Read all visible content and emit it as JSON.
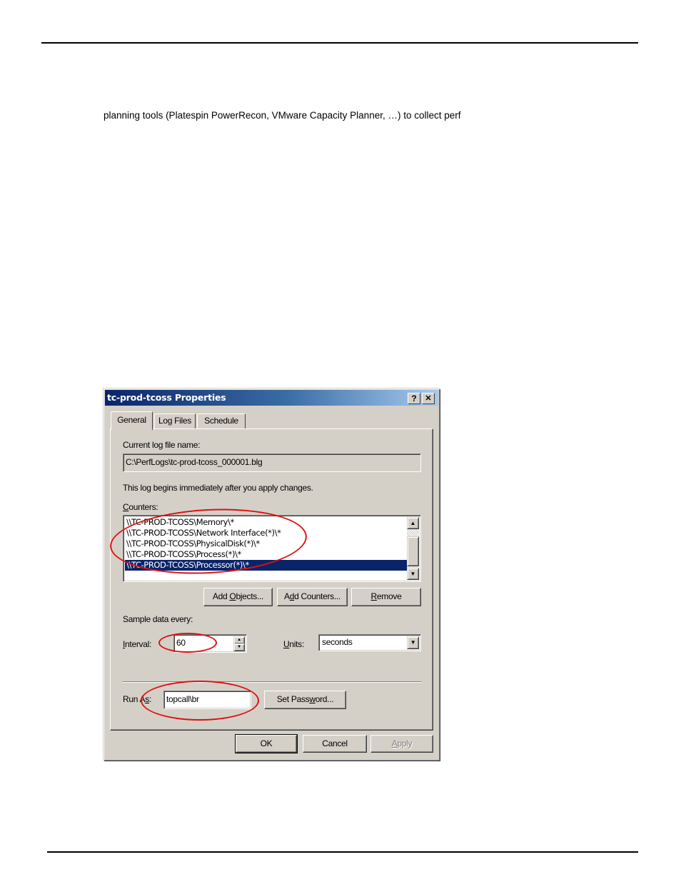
{
  "document": {
    "body_text": "planning tools (Platespin PowerRecon, VMware Capacity Planner, …) to collect perf"
  },
  "dialog": {
    "title": "tc-prod-tcoss Properties",
    "help_button": "?",
    "close_button": "✕",
    "tabs": [
      {
        "label": "General",
        "active": true
      },
      {
        "label": "Log Files",
        "active": false
      },
      {
        "label": "Schedule",
        "active": false
      }
    ],
    "current_log_label": "Current log file name:",
    "current_log_value": "C:\\PerfLogs\\tc-prod-tcoss_000001.blg",
    "log_begins_text": "This log begins immediately after you apply changes.",
    "counters_label_ul": "C",
    "counters_label_rest": "ounters:",
    "counters": [
      {
        "text": "\\\\TC-PROD-TCOSS\\Memory\\*",
        "selected": false
      },
      {
        "text": "\\\\TC-PROD-TCOSS\\Network Interface(*)\\*",
        "selected": false
      },
      {
        "text": "\\\\TC-PROD-TCOSS\\PhysicalDisk(*)\\*",
        "selected": false
      },
      {
        "text": "\\\\TC-PROD-TCOSS\\Process(*)\\*",
        "selected": false
      },
      {
        "text": "\\\\TC-PROD-TCOSS\\Processor(*)\\*",
        "selected": true
      }
    ],
    "add_objects": {
      "pre": "Add ",
      "ul": "O",
      "post": "bjects..."
    },
    "add_counters": {
      "pre": "A",
      "ul": "d",
      "post": "d Counters..."
    },
    "remove": {
      "pre": "",
      "ul": "R",
      "post": "emove"
    },
    "sample_label": "Sample data every:",
    "interval_label": {
      "ul": "I",
      "post": "nterval:"
    },
    "interval_value": "60",
    "units_label": {
      "ul": "U",
      "post": "nits:"
    },
    "units_value": "seconds",
    "run_as_label": {
      "pre": "Run A",
      "ul": "s",
      "post": ":"
    },
    "run_as_value": "topcall\\br",
    "set_password": {
      "pre": "Set Pass",
      "ul": "w",
      "post": "ord..."
    },
    "ok_label": "OK",
    "cancel_label": "Cancel",
    "apply": {
      "ul": "A",
      "post": "pply"
    },
    "highlight_color": "#e01010",
    "selection_color": "#0a246a"
  }
}
